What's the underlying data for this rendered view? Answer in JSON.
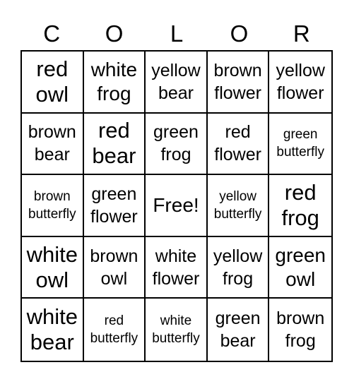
{
  "header": [
    "C",
    "O",
    "L",
    "O",
    "R"
  ],
  "cells": [
    {
      "l1": "red",
      "l2": "owl",
      "size": "xl"
    },
    {
      "l1": "white",
      "l2": "frog",
      "size": "l"
    },
    {
      "l1": "yellow",
      "l2": "bear",
      "size": "m"
    },
    {
      "l1": "brown",
      "l2": "flower",
      "size": "m"
    },
    {
      "l1": "yellow",
      "l2": "flower",
      "size": "m"
    },
    {
      "l1": "brown",
      "l2": "bear",
      "size": "m"
    },
    {
      "l1": "red",
      "l2": "bear",
      "size": "xl"
    },
    {
      "l1": "green",
      "l2": "frog",
      "size": "m"
    },
    {
      "l1": "red",
      "l2": "flower",
      "size": "m"
    },
    {
      "l1": "green",
      "l2": "butterfly",
      "size": "s"
    },
    {
      "l1": "brown",
      "l2": "butterfly",
      "size": "s"
    },
    {
      "l1": "green",
      "l2": "flower",
      "size": "m"
    },
    {
      "l1": "Free!",
      "l2": "",
      "size": "l"
    },
    {
      "l1": "yellow",
      "l2": "butterfly",
      "size": "s"
    },
    {
      "l1": "red",
      "l2": "frog",
      "size": "xl"
    },
    {
      "l1": "white",
      "l2": "owl",
      "size": "xl"
    },
    {
      "l1": "brown",
      "l2": "owl",
      "size": "m"
    },
    {
      "l1": "white",
      "l2": "flower",
      "size": "m"
    },
    {
      "l1": "yellow",
      "l2": "frog",
      "size": "m"
    },
    {
      "l1": "green",
      "l2": "owl",
      "size": "l"
    },
    {
      "l1": "white",
      "l2": "bear",
      "size": "xl"
    },
    {
      "l1": "red",
      "l2": "butterfly",
      "size": "s"
    },
    {
      "l1": "white",
      "l2": "butterfly",
      "size": "s"
    },
    {
      "l1": "green",
      "l2": "bear",
      "size": "m"
    },
    {
      "l1": "brown",
      "l2": "frog",
      "size": "m"
    }
  ]
}
